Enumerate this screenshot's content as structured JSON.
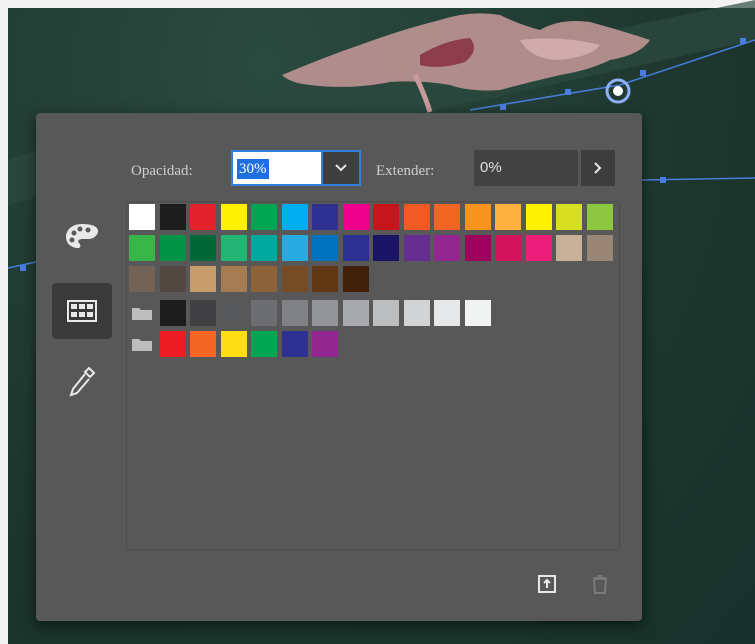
{
  "panel": {
    "opacity_label": "Opacidad:",
    "opacity_value": "30%",
    "extend_label": "Extender:",
    "extend_value": "0%"
  },
  "side_tabs": [
    {
      "name": "color-picker-tab",
      "icon": "palette-icon",
      "active": false
    },
    {
      "name": "swatches-tab",
      "icon": "swatches-icon",
      "active": true
    },
    {
      "name": "eyedropper-tab",
      "icon": "eyedropper-icon",
      "active": false
    }
  ],
  "swatch_rows": [
    {
      "folder": false,
      "colors": [
        "#ffffff",
        "#1d1d1d",
        "#e3232b",
        "#fff200",
        "#00a651",
        "#00adef",
        "#2e3192",
        "#ec008c",
        "#c4161c",
        "#f15a24",
        "#f26522",
        "#f7941d",
        "#fbb040",
        "#fff200",
        "#d7df23",
        "#8dc63f"
      ]
    },
    {
      "folder": false,
      "colors": [
        "#39b54a",
        "#009245",
        "#006837",
        "#22b573",
        "#00a99d",
        "#29abe2",
        "#0071bc",
        "#2e3192",
        "#1b1464",
        "#662d91",
        "#93278f",
        "#9e005d",
        "#d4145a",
        "#ed1e79",
        "#c7b299",
        "#998675"
      ]
    },
    {
      "folder": false,
      "colors": [
        "#736357",
        "#534741",
        "#c69c6d",
        "#a67c52",
        "#8c6239",
        "#754c24",
        "#603813",
        "#42210b"
      ]
    },
    {
      "folder": true,
      "colors": [
        "#1d1d1d",
        "#414042",
        "#58595b",
        "#6d6e71",
        "#808285",
        "#939598",
        "#a7a9ac",
        "#bcbec0",
        "#d1d3d4",
        "#e6e7e8",
        "#f1f2f2"
      ]
    },
    {
      "folder": true,
      "colors": [
        "#ed1c24",
        "#f26522",
        "#ffde17",
        "#00a651",
        "#2e3192",
        "#92278f"
      ]
    }
  ],
  "footer": {
    "new_swatch_icon": "new-swatch-icon",
    "delete_icon": "trash-icon"
  },
  "colors": {
    "panel_bg": "#585858",
    "accent": "#2f7fe0",
    "canvas_bg": "#1f3a32"
  }
}
